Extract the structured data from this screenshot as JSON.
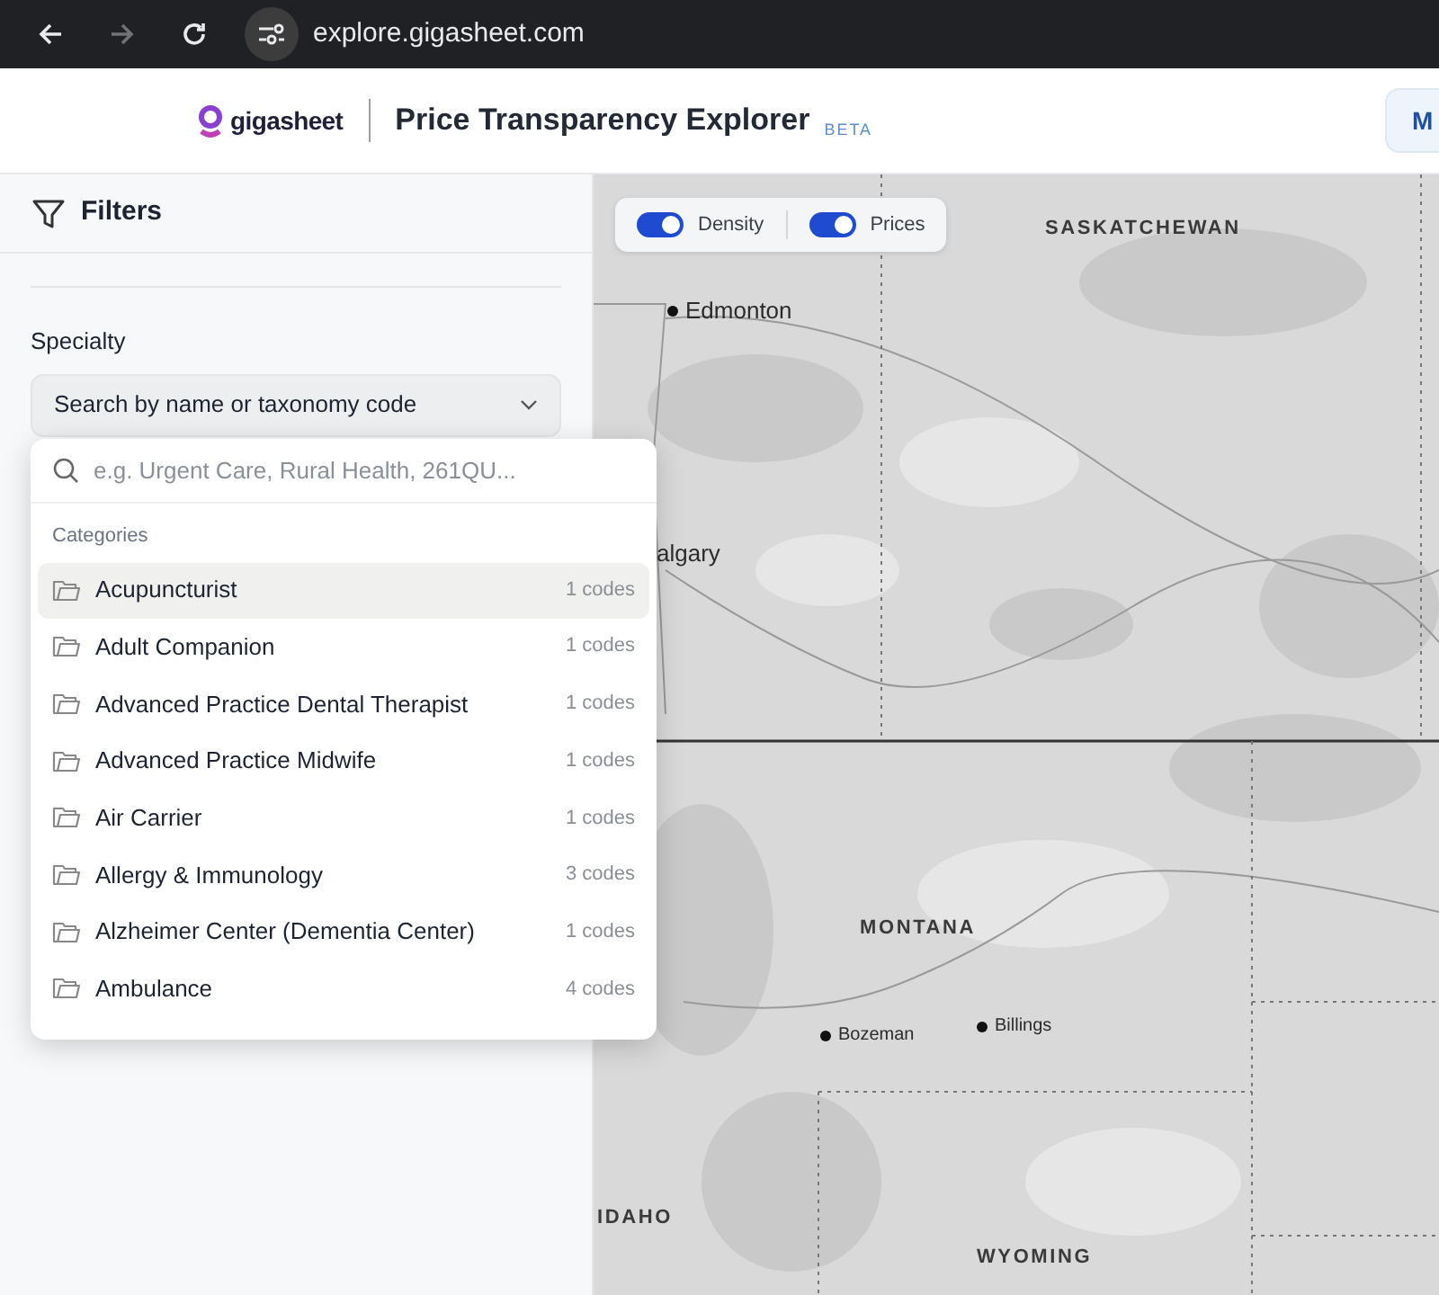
{
  "browser": {
    "url": "explore.gigasheet.com",
    "forward_disabled": true
  },
  "header": {
    "brand": "gigasheet",
    "title": "Price Transparency Explorer",
    "badge": "BETA",
    "button": "M"
  },
  "sidebar": {
    "title": "Filters",
    "specialty_label": "Specialty",
    "specialty_select": "Search by name or taxonomy code",
    "dropdown": {
      "search_placeholder": "e.g. Urgent Care, Rural Health, 261QU...",
      "section": "Categories",
      "items": [
        {
          "name": "Acupuncturist",
          "count": "1 codes",
          "selected": true
        },
        {
          "name": "Adult Companion",
          "count": "1 codes",
          "selected": false
        },
        {
          "name": "Advanced Practice Dental Therapist",
          "count": "1 codes",
          "selected": false
        },
        {
          "name": "Advanced Practice Midwife",
          "count": "1 codes",
          "selected": false
        },
        {
          "name": "Air Carrier",
          "count": "1 codes",
          "selected": false
        },
        {
          "name": "Allergy & Immunology",
          "count": "3 codes",
          "selected": false
        },
        {
          "name": "Alzheimer Center (Dementia Center)",
          "count": "1 codes",
          "selected": false
        },
        {
          "name": "Ambulance",
          "count": "4 codes",
          "selected": false
        }
      ]
    }
  },
  "map": {
    "toggles": [
      {
        "label": "Density",
        "on": true
      },
      {
        "label": "Prices",
        "on": true
      }
    ],
    "labels": [
      {
        "kind": "region",
        "text": "SASKATCHEWAN"
      },
      {
        "kind": "city",
        "text": "Edmonton"
      },
      {
        "kind": "cut",
        "text": "algary"
      },
      {
        "kind": "region",
        "text": "MONTANA"
      },
      {
        "kind": "small-city",
        "text": "Bozeman"
      },
      {
        "kind": "small-city",
        "text": "Billings"
      },
      {
        "kind": "region",
        "text": "IDAHO"
      },
      {
        "kind": "region",
        "text": "WYOMING"
      }
    ]
  }
}
